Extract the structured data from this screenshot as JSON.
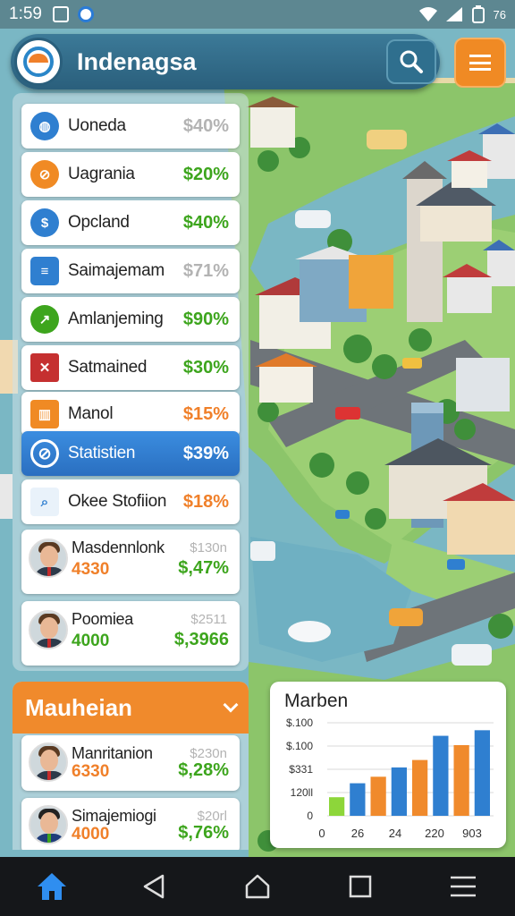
{
  "status_bar": {
    "time": "1:59",
    "battery": "76"
  },
  "header": {
    "title": "Indenagsa",
    "search_icon": "search-icon",
    "menu_icon": "hamburger-menu-icon"
  },
  "list": [
    {
      "name": "Uoneda",
      "value": "$40%",
      "value_color": "grey",
      "icon": "globe-icon",
      "icon_color": "#2f7fd0"
    },
    {
      "name": "Uagrania",
      "value": "$20%",
      "value_color": "green",
      "icon": "compass-icon",
      "icon_color": "#f08a24"
    },
    {
      "name": "Opcland",
      "value": "$40%",
      "value_color": "green",
      "icon": "dollar-icon",
      "icon_color": "#2f7fd0"
    },
    {
      "name": "Saimajemam",
      "value": "$71%",
      "value_color": "grey",
      "icon": "card-icon",
      "icon_color": "#2f7fd0"
    },
    {
      "name": "Amlanjeming",
      "value": "$90%",
      "value_color": "green",
      "icon": "trend-icon",
      "icon_color": "#3da51d"
    },
    {
      "name": "Satmained",
      "value": "$30%",
      "value_color": "green",
      "icon": "flag-icon",
      "icon_color": "#c53030"
    },
    {
      "name": "Manol",
      "value": "$15%",
      "value_color": "orange",
      "icon": "building-icon",
      "icon_color": "#f08a24"
    },
    {
      "name": "Statistien",
      "value": "$39%",
      "value_color": "white",
      "icon": "no-entry-icon",
      "icon_color": "#ffffff",
      "active": true
    },
    {
      "name": "Okee Stofiion",
      "value": "$18%",
      "value_color": "orange",
      "icon": "magnifier-chart-icon",
      "icon_color": "#2f7fd0"
    }
  ],
  "people": [
    {
      "name": "Masdennlonk",
      "number": "4330",
      "number_color": "orange",
      "sub": "$130n",
      "value": "$,47%"
    },
    {
      "name": "Poomiea",
      "number": "4000",
      "number_color": "green",
      "sub": "$2511",
      "value": "$,3966"
    }
  ],
  "bottom_panel": {
    "title": "Mauheian",
    "people": [
      {
        "name": "Manritanion",
        "number": "6330",
        "number_color": "orange",
        "sub": "$230n",
        "value": "$,28%"
      },
      {
        "name": "Simajemiogi",
        "number": "4000",
        "number_color": "orange",
        "sub": "$20rl",
        "value": "$,76%"
      }
    ]
  },
  "chart_data": {
    "type": "bar",
    "title": "Marben",
    "y_tick_labels": [
      "$.100",
      "$.100",
      "$331",
      "120ll",
      "0"
    ],
    "x_tick_labels": [
      "0",
      "26",
      "24",
      "220",
      "903"
    ],
    "colors": {
      "green": "#8dd63a",
      "blue": "#2f7fd0",
      "orange": "#f08a2c"
    },
    "bars": [
      {
        "color": "green",
        "value": 0.2
      },
      {
        "color": "blue",
        "value": 0.35
      },
      {
        "color": "orange",
        "value": 0.42
      },
      {
        "color": "blue",
        "value": 0.52
      },
      {
        "color": "orange",
        "value": 0.6
      },
      {
        "color": "blue",
        "value": 0.86
      },
      {
        "color": "orange",
        "value": 0.76
      },
      {
        "color": "blue",
        "value": 0.92
      }
    ],
    "ylim": [
      0,
      1
    ],
    "grid": true
  },
  "navbar": {
    "items": [
      "home-icon",
      "back-icon",
      "home-outline-icon",
      "recents-icon",
      "menu-lines-icon"
    ]
  }
}
